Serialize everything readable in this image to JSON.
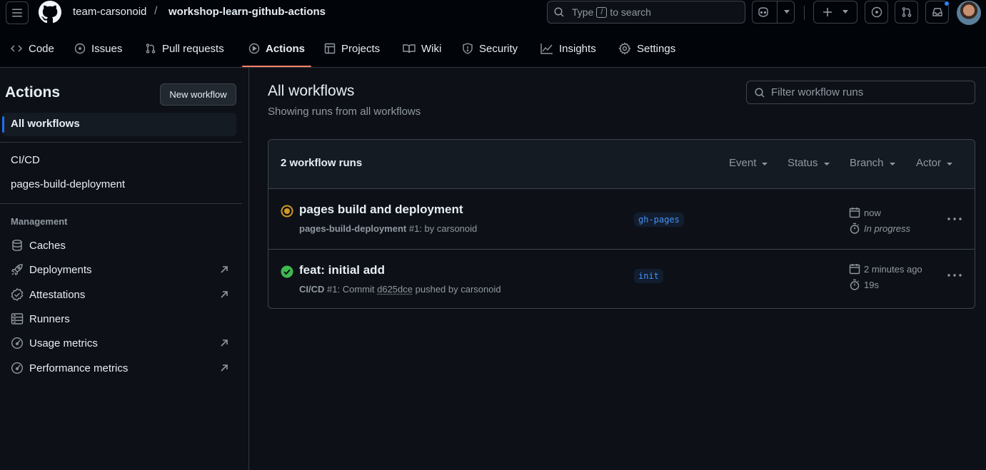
{
  "header": {
    "owner": "team-carsonoid",
    "separator": "/",
    "repo": "workshop-learn-github-actions",
    "search_prefix": "Type",
    "search_key": "/",
    "search_suffix": "to search"
  },
  "nav": {
    "tabs": [
      {
        "label": "Code"
      },
      {
        "label": "Issues"
      },
      {
        "label": "Pull requests"
      },
      {
        "label": "Actions"
      },
      {
        "label": "Projects"
      },
      {
        "label": "Wiki"
      },
      {
        "label": "Security"
      },
      {
        "label": "Insights"
      },
      {
        "label": "Settings"
      }
    ],
    "active": "Actions"
  },
  "sidebar": {
    "title": "Actions",
    "new_workflow": "New workflow",
    "all_workflows": "All workflows",
    "workflows": [
      "CI/CD",
      "pages-build-deployment"
    ],
    "management_heading": "Management",
    "management": [
      {
        "label": "Caches",
        "icon": "database-icon",
        "external": false
      },
      {
        "label": "Deployments",
        "icon": "rocket-icon",
        "external": true
      },
      {
        "label": "Attestations",
        "icon": "verified-icon",
        "external": true
      },
      {
        "label": "Runners",
        "icon": "server-icon",
        "external": false
      },
      {
        "label": "Usage metrics",
        "icon": "meter-icon",
        "external": true
      },
      {
        "label": "Performance metrics",
        "icon": "meter-icon",
        "external": true
      }
    ]
  },
  "main": {
    "title": "All workflows",
    "subtitle": "Showing runs from all workflows",
    "filter_placeholder": "Filter workflow runs",
    "run_count": "2 workflow runs",
    "filters": [
      "Event",
      "Status",
      "Branch",
      "Actor"
    ],
    "runs": [
      {
        "title": "pages build and deployment",
        "workflow": "pages-build-deployment",
        "meta_rest": "#1: by carsonoid",
        "branch": "gh-pages",
        "time": "now",
        "duration": "In progress",
        "status": "in-progress",
        "status_color": "#d29922"
      },
      {
        "title": "feat: initial add",
        "workflow": "CI/CD",
        "meta_pre": "#1: Commit",
        "commit": "d625dce",
        "meta_post": "pushed by carsonoid",
        "branch": "init",
        "time": "2 minutes ago",
        "duration": "19s",
        "status": "success",
        "status_color": "#3fb950"
      }
    ]
  }
}
